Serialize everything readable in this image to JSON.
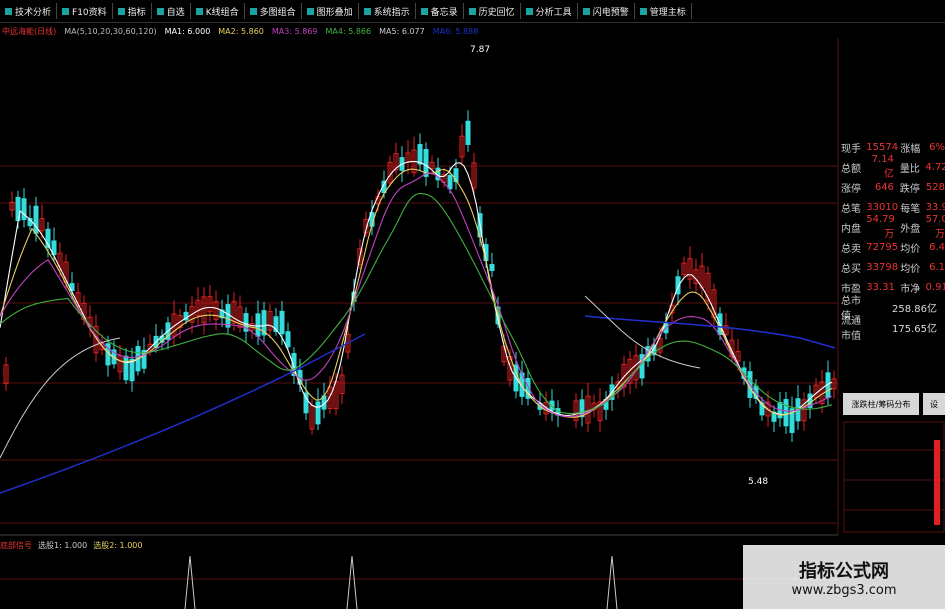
{
  "toolbar": {
    "items": [
      "技术分析",
      "F10资料",
      "指标",
      "自选",
      "K线组合",
      "多图组合",
      "图形叠加",
      "系统指示",
      "备忘录",
      "历史回忆",
      "分析工具",
      "闪电预警",
      "管理主标"
    ]
  },
  "infobar": {
    "stock": "中远海能(日线)",
    "ma_params": "MA(5,10,20,30,60,120)",
    "ma1": "MA1: 6.000",
    "ma2": "MA2: 5.860",
    "ma3": "MA3: 5.869",
    "ma4": "MA4: 5.866",
    "ma5": "MA5: 6.077",
    "ma6": "MA6: 5.888"
  },
  "chart_labels": {
    "high_price": "7.87",
    "low_price": "5.48"
  },
  "right_panel": {
    "rows": [
      {
        "l1": "现手",
        "v1": "15574",
        "l2": "涨幅",
        "v2": "6%"
      },
      {
        "l1": "总额",
        "v1": "7.14亿",
        "l2": "量比",
        "v2": "4.72"
      },
      {
        "l1": "涨停",
        "v1": "646",
        "l2": "跌停",
        "v2": "528"
      },
      {
        "l1": "总笔",
        "v1": "33010",
        "l2": "每笔",
        "v2": "33.9"
      },
      {
        "l1": "内盘",
        "v1": "54.79万",
        "l2": "外盘",
        "v2": "57.09万"
      },
      {
        "l1": "总卖",
        "v1": "72795",
        "l2": "均价",
        "v2": "6.4"
      },
      {
        "l1": "总买",
        "v1": "33798",
        "l2": "均价",
        "v2": "6.1"
      },
      {
        "l1": "市盈",
        "v1": "33.31",
        "l2": "市净",
        "v2": "0.91"
      },
      {
        "l1": "总市值",
        "wide": "258.86亿"
      },
      {
        "l1": "流通市值",
        "wide": "175.65亿"
      }
    ]
  },
  "buttons": {
    "main": "涨跌柱/筹码分布",
    "side": "设"
  },
  "indicator": {
    "name": "底部信号",
    "p1": "选股1: 1.000",
    "p2": "选股2: 1.000"
  },
  "watermark": {
    "title": "指标公式网",
    "url": "www.zbgs3.com"
  },
  "colors": {
    "up": "#e02020",
    "down": "#33dddd",
    "ma_white": "#ffffff",
    "ma_yellow": "#e8d060",
    "ma_purple": "#c040c0",
    "ma_green": "#40b040",
    "ma_blue": "#2030d0",
    "ma_gray": "#cccccc"
  }
}
